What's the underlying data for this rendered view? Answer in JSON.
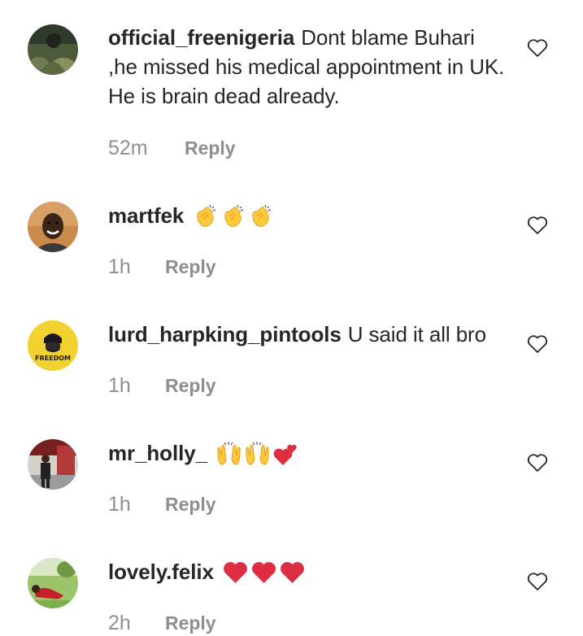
{
  "comments": [
    {
      "username": "official_freenigeria",
      "text": "Dont blame Buhari ,he missed his medical appointment in UK. He is brain dead already.",
      "time": "52m",
      "reply_label": "Reply",
      "avatar_icon": "camouflage-avatar"
    },
    {
      "username": "martfek",
      "text": "",
      "emojis": [
        "clapping-hands",
        "clapping-hands",
        "clapping-hands"
      ],
      "time": "1h",
      "reply_label": "Reply",
      "avatar_icon": "smiling-man-avatar"
    },
    {
      "username": "lurd_harpking_pintools",
      "text": "U said it all bro",
      "time": "1h",
      "reply_label": "Reply",
      "avatar_icon": "freedom-logo-avatar",
      "avatar_text": "FREEDOM"
    },
    {
      "username": "mr_holly_",
      "text": "",
      "emojis": [
        "raising-hands",
        "raising-hands",
        "two-hearts"
      ],
      "time": "1h",
      "reply_label": "Reply",
      "avatar_icon": "standing-person-avatar"
    },
    {
      "username": "lovely.felix",
      "text": "",
      "emojis": [
        "red-heart",
        "red-heart",
        "red-heart"
      ],
      "time": "2h",
      "reply_label": "Reply",
      "avatar_icon": "reclining-person-avatar"
    }
  ],
  "colors": {
    "text": "#262626",
    "meta": "#8e8e8e",
    "emoji_yellow": "#FFC83D",
    "heart_red": "#DD2E44"
  }
}
